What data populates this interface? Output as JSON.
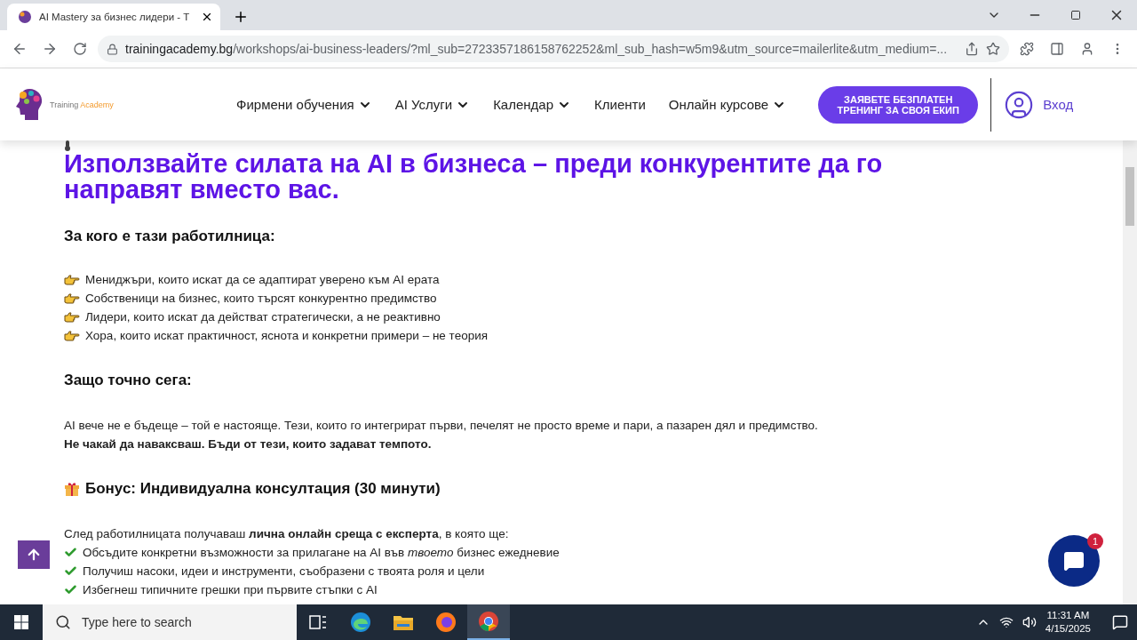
{
  "browser": {
    "tab_title": "AI Mastery за бизнес лидери - T",
    "url_host": "trainingacademy.bg",
    "url_path": "/workshops/ai-business-leaders/?ml_sub=2723357186158762252&ml_sub_hash=w5m9&utm_source=mailerlite&utm_medium=..."
  },
  "site_header": {
    "logo": {
      "word_1": "Training",
      "word_2": "Academy"
    },
    "nav": [
      {
        "label": "Фирмени обучения",
        "dropdown": true
      },
      {
        "label": "AI Услуги",
        "dropdown": true
      },
      {
        "label": "Календар",
        "dropdown": true
      },
      {
        "label": "Клиенти",
        "dropdown": false
      },
      {
        "label": "Онлайн курсове",
        "dropdown": true
      }
    ],
    "cta": "ЗАЯВЕТЕ БЕЗПЛАТЕН ТРЕНИНГ ЗА СВОЯ ЕКИП",
    "login": "Вход"
  },
  "content": {
    "headline": [
      "Използвайте силата на AI в бизнеса – преди конкурентите да го",
      "направят вместо вас."
    ],
    "audience_heading": "За кого е тази работилница:",
    "audience": [
      "Мениджъри, които искат да се адаптират уверено към AI ерата",
      "Собственици на бизнес, които търсят конкурентно предимство",
      "Лидери, които искат да действат стратегически, а не реактивно",
      "Хора, които искат практичност, яснота и конкретни примери – не теория"
    ],
    "why_heading": "Защо точно сега:",
    "why_text": "AI вече не е бъдеще – той е настояще. Тези, които го интегрират първи, печелят не просто време и пари, а пазарен дял и предимство.",
    "why_bold": "Не чакай да наваксваш. Бъди от тези, които задават темпото.",
    "bonus_heading": "Бонус: Индивидуална консултация (30 минути)",
    "bonus_intro": "След работилницата получаваш **лична онлайн среща с експерта**, в която ще:",
    "bonus_items": [
      "Обсъдите конкретни възможности за прилагане на AI във *твоето* бизнес ежедневие",
      "Получиш насоки, идеи и инструменти, съобразени с твоята роля и цели",
      "Избегнеш типичните грешки при първите стъпки с AI"
    ]
  },
  "chat_badge": "1",
  "taskbar": {
    "search_placeholder": "Type here to search",
    "time": "11:31 AM",
    "date": "4/15/2025"
  }
}
